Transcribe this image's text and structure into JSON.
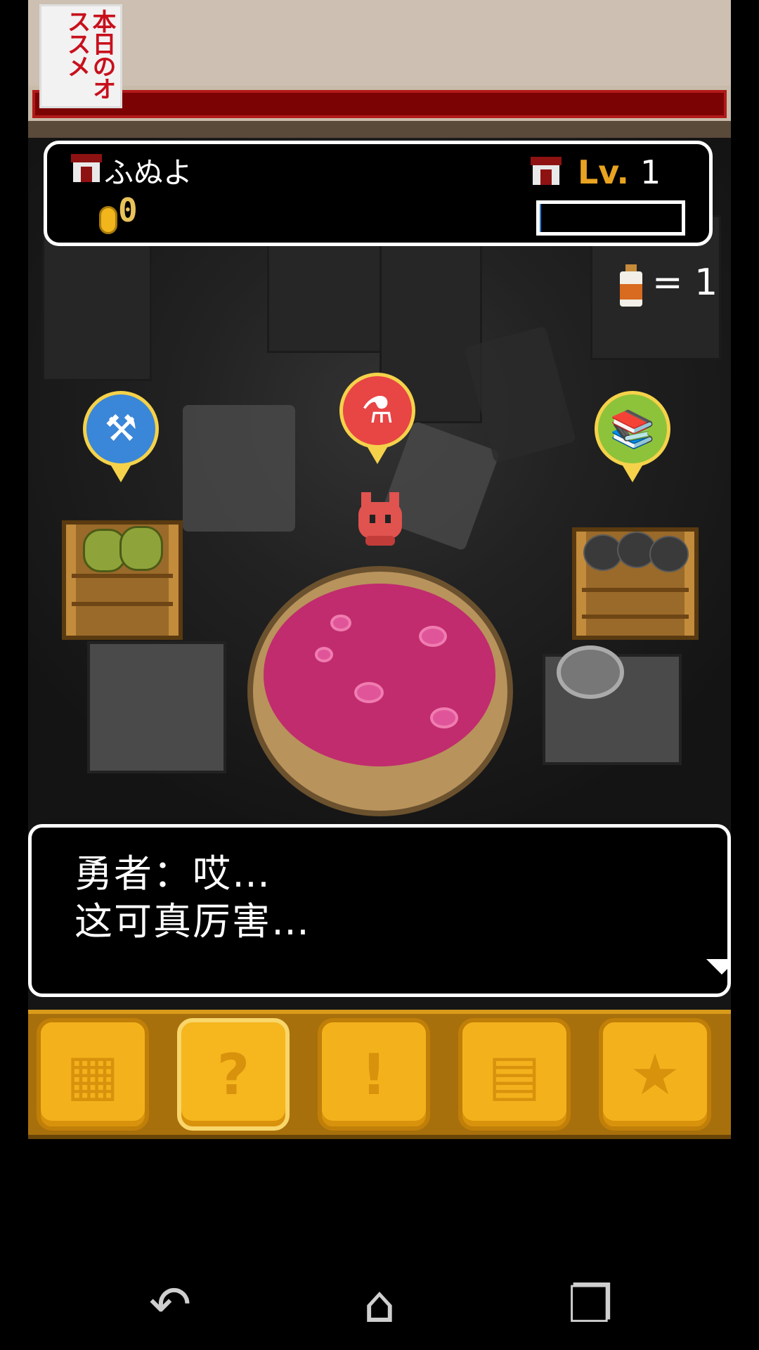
{
  "logo": {
    "text": "本日のオススメ"
  },
  "status": {
    "shop_name": "ふぬよ",
    "coins": "0",
    "level_label": "Lv.",
    "level_value": "1",
    "xp_fraction": 0.01
  },
  "inventory": {
    "potion_count": "= 1"
  },
  "pins": [
    {
      "name": "weapon-pin",
      "icon": "sword-hammer-icon",
      "color": "#3a86d8"
    },
    {
      "name": "potion-pin",
      "icon": "flask-icon",
      "color": "#e84545"
    },
    {
      "name": "book-pin",
      "icon": "book-icon",
      "color": "#8dc33a"
    }
  ],
  "dialog": {
    "line1": "勇者：哎…",
    "line2": "这可真厉害…"
  },
  "menu": [
    {
      "name": "shop-menu-button",
      "icon": "shop-icon",
      "glyph": "▦"
    },
    {
      "name": "research-menu-button",
      "icon": "flask-question-icon",
      "glyph": "?"
    },
    {
      "name": "event-menu-button",
      "icon": "alert-icon",
      "glyph": "!"
    },
    {
      "name": "storage-menu-button",
      "icon": "shelves-icon",
      "glyph": "▤"
    },
    {
      "name": "favorites-menu-button",
      "icon": "star-icon",
      "glyph": "★"
    }
  ],
  "navbar": {
    "back": "↶",
    "home": "⌂",
    "recents": "❐"
  },
  "colors": {
    "accent": "#f3b21c",
    "banner_red": "#7c0303",
    "liquid": "#c12c6e"
  }
}
